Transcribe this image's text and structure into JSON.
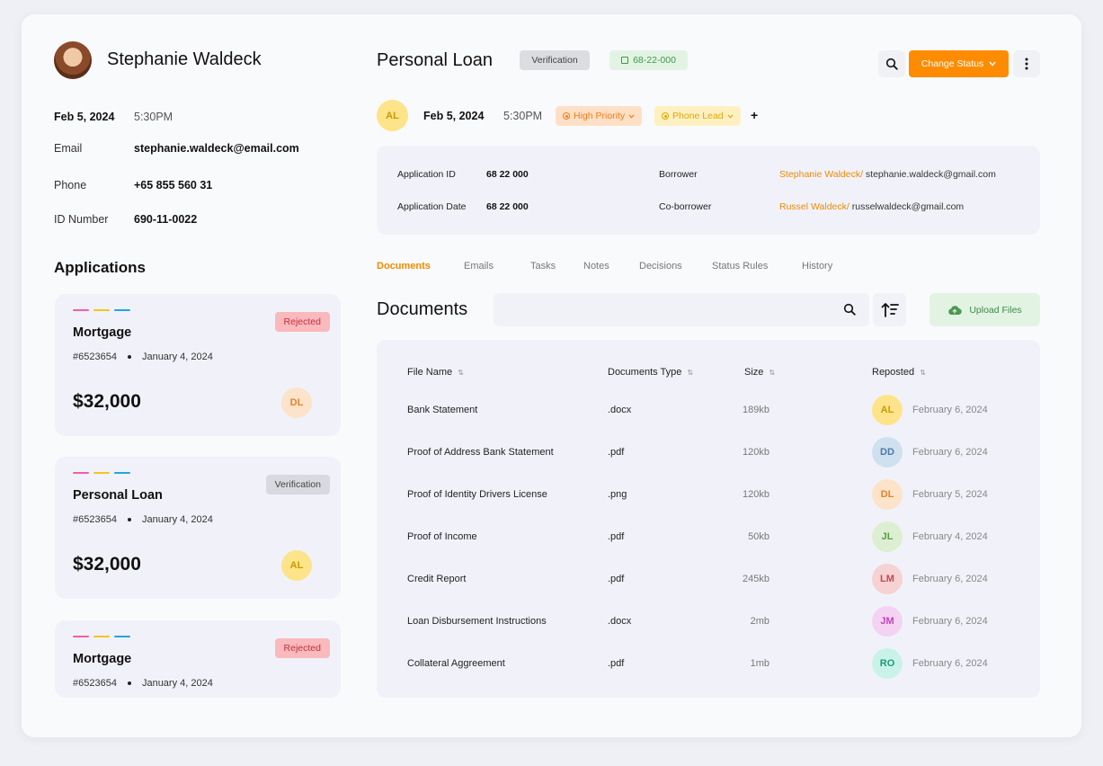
{
  "profile": {
    "name": "Stephanie Waldeck",
    "date": "Feb 5, 2024",
    "time": "5:30PM",
    "email_label": "Email",
    "email": "stephanie.waldeck@email.com",
    "phone_label": "Phone",
    "phone": "+65 855 560 31",
    "id_label": "ID Number",
    "id_number": "690-11-0022"
  },
  "applications": {
    "title": "Applications",
    "items": [
      {
        "name": "Mortgage",
        "ref": "#6523654",
        "date": "January 4, 2024",
        "amount": "$32,000",
        "status": "Rejected",
        "assignee": "DL"
      },
      {
        "name": "Personal Loan",
        "ref": "#6523654",
        "date": "January 4, 2024",
        "amount": "$32,000",
        "status": "Verification",
        "assignee": "AL"
      },
      {
        "name": "Mortgage",
        "ref": "#6523654",
        "date": "January 4, 2024",
        "status": "Rejected"
      }
    ]
  },
  "header": {
    "title": "Personal Loan",
    "status_pill": "Verification",
    "id_pill": "68-22-000",
    "change_status": "Change Status",
    "assignee": "AL",
    "date": "Feb 5, 2024",
    "time": "5:30PM",
    "priority": "High Priority",
    "lead": "Phone Lead",
    "add": "+"
  },
  "info": {
    "app_id_label": "Application ID",
    "app_id": "68 22 000",
    "app_date_label": "Application Date",
    "app_date": "68 22 000",
    "borrower_label": "Borrower",
    "borrower_name": "Stephanie Waldeck/",
    "borrower_email": " stephanie.waldeck@gmail.com",
    "coborrower_label": "Co-borrower",
    "coborrower_name": "Russel Waldeck/",
    "coborrower_email": " russelwaldeck@gmail.com"
  },
  "tabs": [
    "Documents",
    "Emails",
    "Tasks",
    "Notes",
    "Decisions",
    "Status Rules",
    "History"
  ],
  "documents": {
    "title": "Documents",
    "upload": "Upload Files",
    "columns": [
      "File Name",
      "Documents Type",
      "Size",
      "Reposted"
    ],
    "rows": [
      {
        "name": "Bank Statement",
        "type": ".docx",
        "size": "189kb",
        "user": "AL",
        "date": "February 6, 2024"
      },
      {
        "name": "Proof of Address Bank Statement",
        "type": ".pdf",
        "size": "120kb",
        "user": "DD",
        "date": "February 6, 2024"
      },
      {
        "name": "Proof of Identity Drivers License",
        "type": ".png",
        "size": "120kb",
        "user": "DL",
        "date": "February 5, 2024"
      },
      {
        "name": "Proof of Income",
        "type": ".pdf",
        "size": "50kb",
        "user": "JL",
        "date": "February 4, 2024"
      },
      {
        "name": "Credit Report",
        "type": ".pdf",
        "size": "245kb",
        "user": "LM",
        "date": "February 6, 2024"
      },
      {
        "name": "Loan Disbursement Instructions",
        "type": ".docx",
        "size": "2mb",
        "user": "JM",
        "date": "February 6, 2024"
      },
      {
        "name": "Collateral Aggreement",
        "type": ".pdf",
        "size": "1mb",
        "user": "RO",
        "date": "February 6, 2024"
      }
    ]
  },
  "colors": {
    "accent": "#ff8c00",
    "bar_pink": "#ef5fa7",
    "bar_yellow": "#f5c518",
    "bar_blue": "#1ea7e1"
  }
}
